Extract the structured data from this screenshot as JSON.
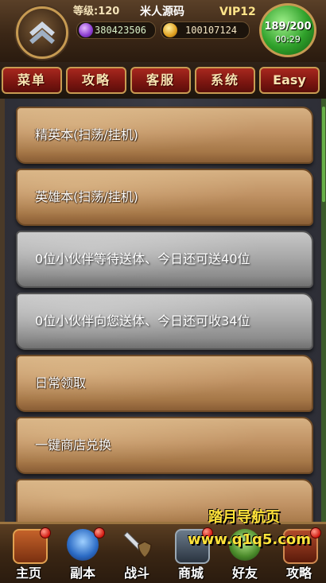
{
  "header": {
    "level_text": "等级:120",
    "player_name": "米人源码",
    "vip": "VIP12",
    "gems": "380423506",
    "gold": "100107124",
    "energy": "189/200",
    "energy_timer": "00:29"
  },
  "tabs": [
    {
      "label": "菜单"
    },
    {
      "label": "攻略"
    },
    {
      "label": "客服"
    },
    {
      "label": "系统"
    },
    {
      "label": "Easy"
    }
  ],
  "list": {
    "items": [
      {
        "label": "精英本(扫荡/挂机)",
        "style": "wood"
      },
      {
        "label": "英雄本(扫荡/挂机)",
        "style": "wood"
      },
      {
        "label": "0位小伙伴等待送体、今日还可送40位",
        "style": "stone"
      },
      {
        "label": "0位小伙伴向您送体、今日还可收34位",
        "style": "stone"
      },
      {
        "label": "日常领取",
        "style": "wood"
      },
      {
        "label": "一键商店兑换",
        "style": "wood"
      }
    ]
  },
  "watermark": {
    "title": "踏月导航页",
    "url": "www.q1q5.com"
  },
  "bottom_nav": [
    {
      "label": "主页",
      "icon": "treasure-chest-icon",
      "notify": true
    },
    {
      "label": "副本",
      "icon": "blue-beast-icon",
      "notify": true
    },
    {
      "label": "战斗",
      "icon": "sword-shield-icon",
      "notify": false
    },
    {
      "label": "商城",
      "icon": "shop-icon",
      "notify": true
    },
    {
      "label": "好友",
      "icon": "friends-icon",
      "notify": false
    },
    {
      "label": "攻略",
      "icon": "guide-icon",
      "notify": true
    }
  ]
}
